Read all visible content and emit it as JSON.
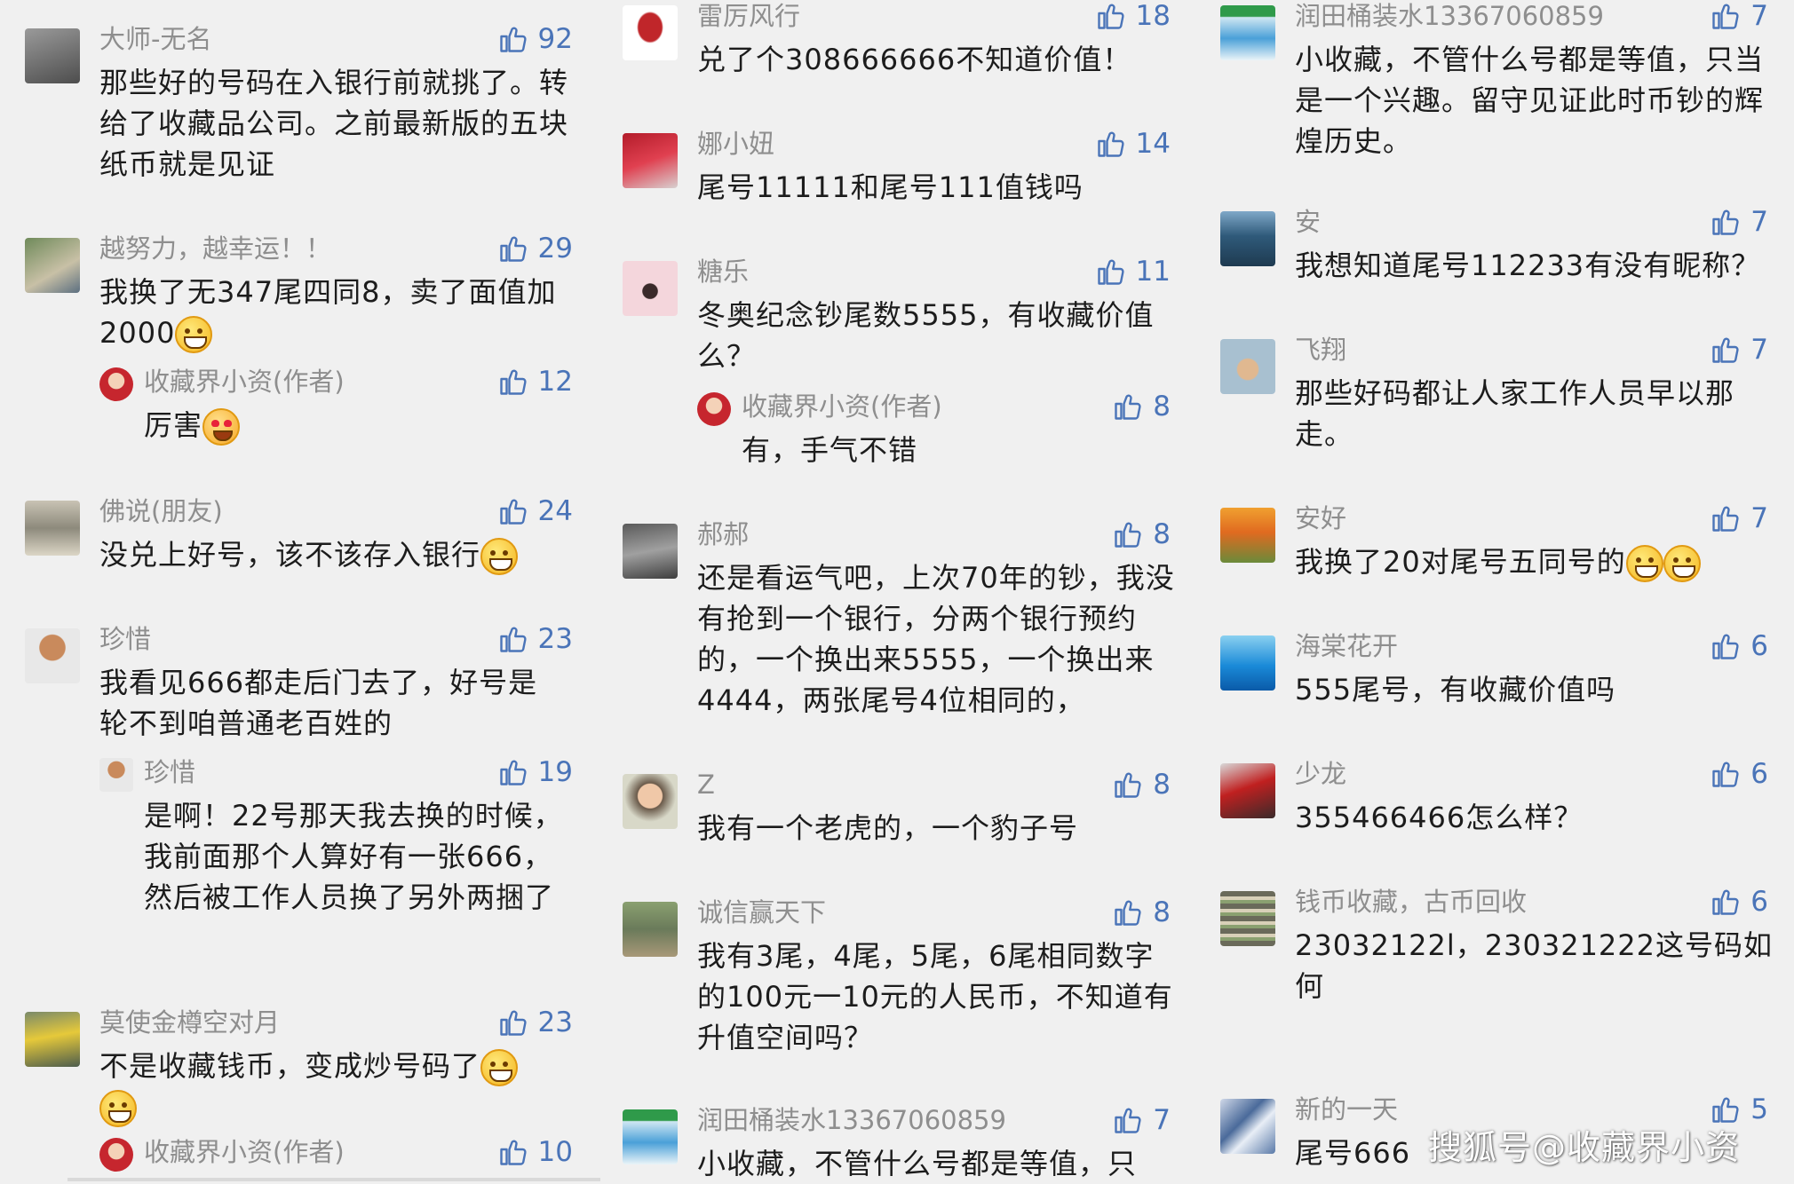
{
  "colors": {
    "like": "#4a74b8",
    "name": "#8e8e8e",
    "text": "#1c1c1c",
    "background": "#f0f0f0"
  },
  "icons": {
    "like": "thumbs-up-icon",
    "emoji_grin": "grinning-emoji-icon",
    "emoji_love": "heart-eyes-emoji-icon"
  },
  "columns": [
    {
      "comments": [
        {
          "name": "大师-无名",
          "likes": "92",
          "text": "那些好的号码在入银行前就挑了。转给了收藏品公司。之前最新版的五块纸币就是见证"
        },
        {
          "name": "越努力，越幸运！！",
          "likes": "29",
          "text": "我换了无347尾四同8，卖了面值加2000"
        },
        {
          "name": "收藏界小资(作者)",
          "likes": "12",
          "text": "厉害",
          "reply": true
        },
        {
          "name": "佛说(朋友)",
          "likes": "24",
          "text": "没兑上好号，该不该存入银行"
        },
        {
          "name": "珍惜",
          "likes": "23",
          "text": "我看见666都走后门去了，好号是轮不到咱普通老百姓的"
        },
        {
          "name": "珍惜",
          "likes": "19",
          "text": "是啊！22号那天我去换的时候，我前面那个人算好有一张666，然后被工作人员换了另外两捆了",
          "reply": true
        },
        {
          "name": "莫使金樽空对月",
          "likes": "23",
          "text": "不是收藏钱币，变成炒号码了"
        },
        {
          "name": "收藏界小资(作者)",
          "likes": "10",
          "text": "",
          "reply": true
        }
      ]
    },
    {
      "comments": [
        {
          "name": "雷厉风行",
          "likes": "18",
          "text": "兑了个308666666不知道价值！"
        },
        {
          "name": "娜小妞",
          "likes": "14",
          "text": "尾号11111和尾号111值钱吗"
        },
        {
          "name": "糖乐",
          "likes": "11",
          "text": "冬奥纪念钞尾数5555，有收藏价值么？"
        },
        {
          "name": "收藏界小资(作者)",
          "likes": "8",
          "text": "有，手气不错",
          "reply": true
        },
        {
          "name": "郝郝",
          "likes": "8",
          "text": "还是看运气吧，上次70年的钞，我没有抢到一个银行，分两个银行预约的，一个换出来5555，一个换出来4444，两张尾号4位相同的，"
        },
        {
          "name": "Z",
          "likes": "8",
          "text": "我有一个老虎的，一个豹子号"
        },
        {
          "name": "诚信赢天下",
          "likes": "8",
          "text": "我有3尾，4尾，5尾，6尾相同数字的100元一10元的人民币，不知道有升值空间吗？"
        },
        {
          "name": "润田桶装水13367060859",
          "likes": "7",
          "text": "小收藏，不管什么号都是等值，只"
        }
      ]
    },
    {
      "comments": [
        {
          "name": "润田桶装水13367060859",
          "likes": "7",
          "text": "小收藏，不管什么号都是等值，只当是一个兴趣。留守见证此时币钞的辉煌历史。"
        },
        {
          "name": "安",
          "likes": "7",
          "text": "我想知道尾号112233有没有昵称？"
        },
        {
          "name": "飞翔",
          "likes": "7",
          "text": "那些好码都让人家工作人员早以那走。"
        },
        {
          "name": "安好",
          "likes": "7",
          "text": "我换了20对尾号五同号的"
        },
        {
          "name": "海棠花开",
          "likes": "6",
          "text": "555尾号，有收藏价值吗"
        },
        {
          "name": "少龙",
          "likes": "6",
          "text": "355466466怎么样？"
        },
        {
          "name": "钱币收藏，古币回收",
          "likes": "6",
          "text": "23032122l，230321222这号码如何"
        },
        {
          "name": "新的一天",
          "likes": "5",
          "text": "尾号666"
        }
      ]
    }
  ],
  "watermark": "搜狐号@收藏界小资"
}
